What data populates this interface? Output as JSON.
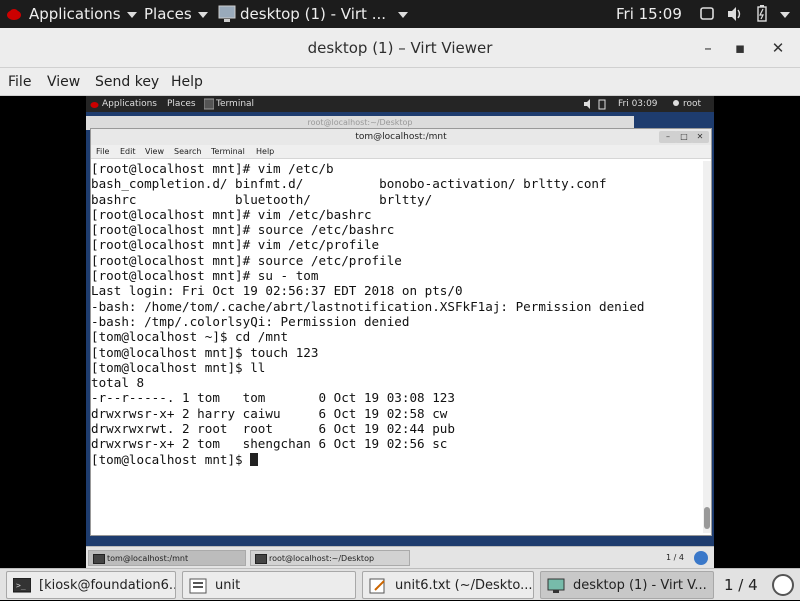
{
  "host_top": {
    "applications": "Applications",
    "places": "Places",
    "window_title": "desktop (1) - Virt ...",
    "clock": "Fri 15:09"
  },
  "viewer": {
    "title": "desktop (1) – Virt Viewer",
    "menu": [
      "File",
      "View",
      "Send key",
      "Help"
    ]
  },
  "guest_top": {
    "applications": "Applications",
    "places": "Places",
    "terminal": "Terminal",
    "clock": "Fri 03:09",
    "user": "root"
  },
  "guest_bg_window_title": "root@localhost:~/Desktop",
  "terminal": {
    "title": "tom@localhost:/mnt",
    "menu": [
      "File",
      "Edit",
      "View",
      "Search",
      "Terminal",
      "Help"
    ],
    "lines": [
      "[root@localhost mnt]# vim /etc/b",
      "bash_completion.d/ binfmt.d/          bonobo-activation/ brltty.conf",
      "bashrc             bluetooth/         brltty/",
      "[root@localhost mnt]# vim /etc/bashrc",
      "[root@localhost mnt]# source /etc/bashrc",
      "[root@localhost mnt]# vim /etc/profile",
      "[root@localhost mnt]# source /etc/profile",
      "[root@localhost mnt]# su - tom",
      "Last login: Fri Oct 19 02:56:37 EDT 2018 on pts/0",
      "-bash: /home/tom/.cache/abrt/lastnotification.XSFkF1aj: Permission denied",
      "-bash: /tmp/.colorlsyQi: Permission denied",
      "[tom@localhost ~]$ cd /mnt",
      "[tom@localhost mnt]$ touch 123",
      "[tom@localhost mnt]$ ll",
      "total 8",
      "-r--r-----. 1 tom   tom       0 Oct 19 03:08 123",
      "drwxrwsr-x+ 2 harry caiwu     6 Oct 19 02:58 cw",
      "drwxrwxrwt. 2 root  root      6 Oct 19 02:44 pub",
      "drwxrwsr-x+ 2 tom   shengchan 6 Oct 19 02:56 sc",
      "[tom@localhost mnt]$ "
    ]
  },
  "guest_taskbar": {
    "tasks": [
      "tom@localhost:/mnt",
      "root@localhost:~/Desktop"
    ],
    "pager": "1 / 4"
  },
  "host_taskbar": {
    "tasks": [
      "[kiosk@foundation6...",
      "unit",
      "unit6.txt (~/Deskto...",
      "desktop (1) - Virt V..."
    ],
    "pager": "1 / 4"
  },
  "colors": {
    "host_panel": "#1c1c1c",
    "guest_desktop": "#1e3c6e",
    "window_chrome": "#ededed"
  }
}
